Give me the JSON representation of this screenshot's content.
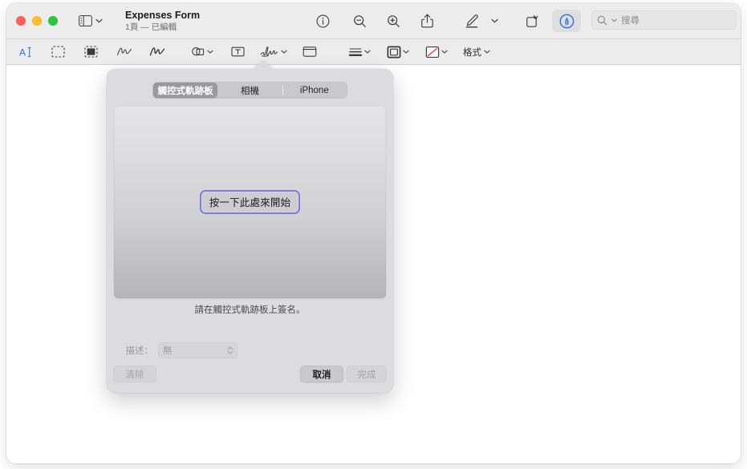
{
  "window": {
    "title": "Expenses Form",
    "subtitle": "1頁 — 已編輯",
    "traffic_lights": [
      "close",
      "minimize",
      "zoom"
    ],
    "sidebar_toggle_icon": "sidebar-icon"
  },
  "toolbar": {
    "items": [
      {
        "name": "info-button",
        "icon": "info-circle-icon"
      },
      {
        "name": "zoom-out-button",
        "icon": "magnifier-minus-icon"
      },
      {
        "name": "zoom-in-button",
        "icon": "magnifier-plus-icon"
      },
      {
        "name": "share-button",
        "icon": "share-icon"
      },
      {
        "name": "markup-pen-button",
        "icon": "pen-underline-icon"
      },
      {
        "name": "markup-options-chevron",
        "icon": "chevron-down-icon"
      },
      {
        "name": "rotate-button",
        "icon": "rotate-left-icon"
      },
      {
        "name": "annotate-button",
        "icon": "markup-circle-pen-icon",
        "active": true
      },
      {
        "name": "signature-toolbar-button",
        "icon": "signature-pad-icon"
      }
    ],
    "accent_color": "#2b6fe8",
    "active_background": "#dededf"
  },
  "search": {
    "placeholder": "搜尋",
    "icon": "search-magnifier-icon",
    "chevron": "chevron-down-icon"
  },
  "markup_bar": {
    "items": [
      {
        "name": "text-selection-tool",
        "icon": "text-select-icon",
        "active": true
      },
      {
        "name": "rectangular-selection-tool",
        "icon": "dashed-rectangle-icon"
      },
      {
        "name": "instant-alpha-tool",
        "icon": "instant-alpha-icon"
      },
      {
        "name": "sketch-tool",
        "icon": "sketch-squiggle-icon"
      },
      {
        "name": "draw-tool",
        "icon": "draw-squiggle-icon"
      },
      {
        "name": "shapes-tool",
        "icon": "shapes-icon",
        "chevron": true
      },
      {
        "name": "text-tool",
        "icon": "text-box-icon"
      },
      {
        "name": "signature-tool",
        "icon": "signature-scribble-icon",
        "chevron": true
      },
      {
        "name": "note-tool",
        "icon": "note-icon"
      },
      {
        "name": "shape-style-tool",
        "icon": "shape-style-lines-icon",
        "chevron": true
      },
      {
        "name": "border-color-tool",
        "icon": "border-color-square-icon",
        "chevron": true
      },
      {
        "name": "fill-color-tool",
        "icon": "fill-color-none-icon",
        "chevron": true
      }
    ],
    "format_label": "格式",
    "format_chevron": "chevron-down-icon"
  },
  "signature_popover": {
    "tabs": [
      {
        "label": "觸控式軌跡板",
        "selected": true
      },
      {
        "label": "相機",
        "selected": false
      },
      {
        "label": "iPhone",
        "selected": false
      }
    ],
    "start_button_label": "按一下此處來開始",
    "start_button_border_color": "#7b7fd8",
    "hint_text": "請在觸控式軌跡板上簽名。",
    "description": {
      "label": "描述：",
      "value": "無",
      "enabled": false
    },
    "buttons": [
      {
        "name": "clear-button",
        "label": "清除",
        "enabled": false
      },
      {
        "name": "cancel-button",
        "label": "取消",
        "enabled": true
      },
      {
        "name": "done-button",
        "label": "完成",
        "enabled": false
      }
    ],
    "background_color": "#dcdcde"
  }
}
